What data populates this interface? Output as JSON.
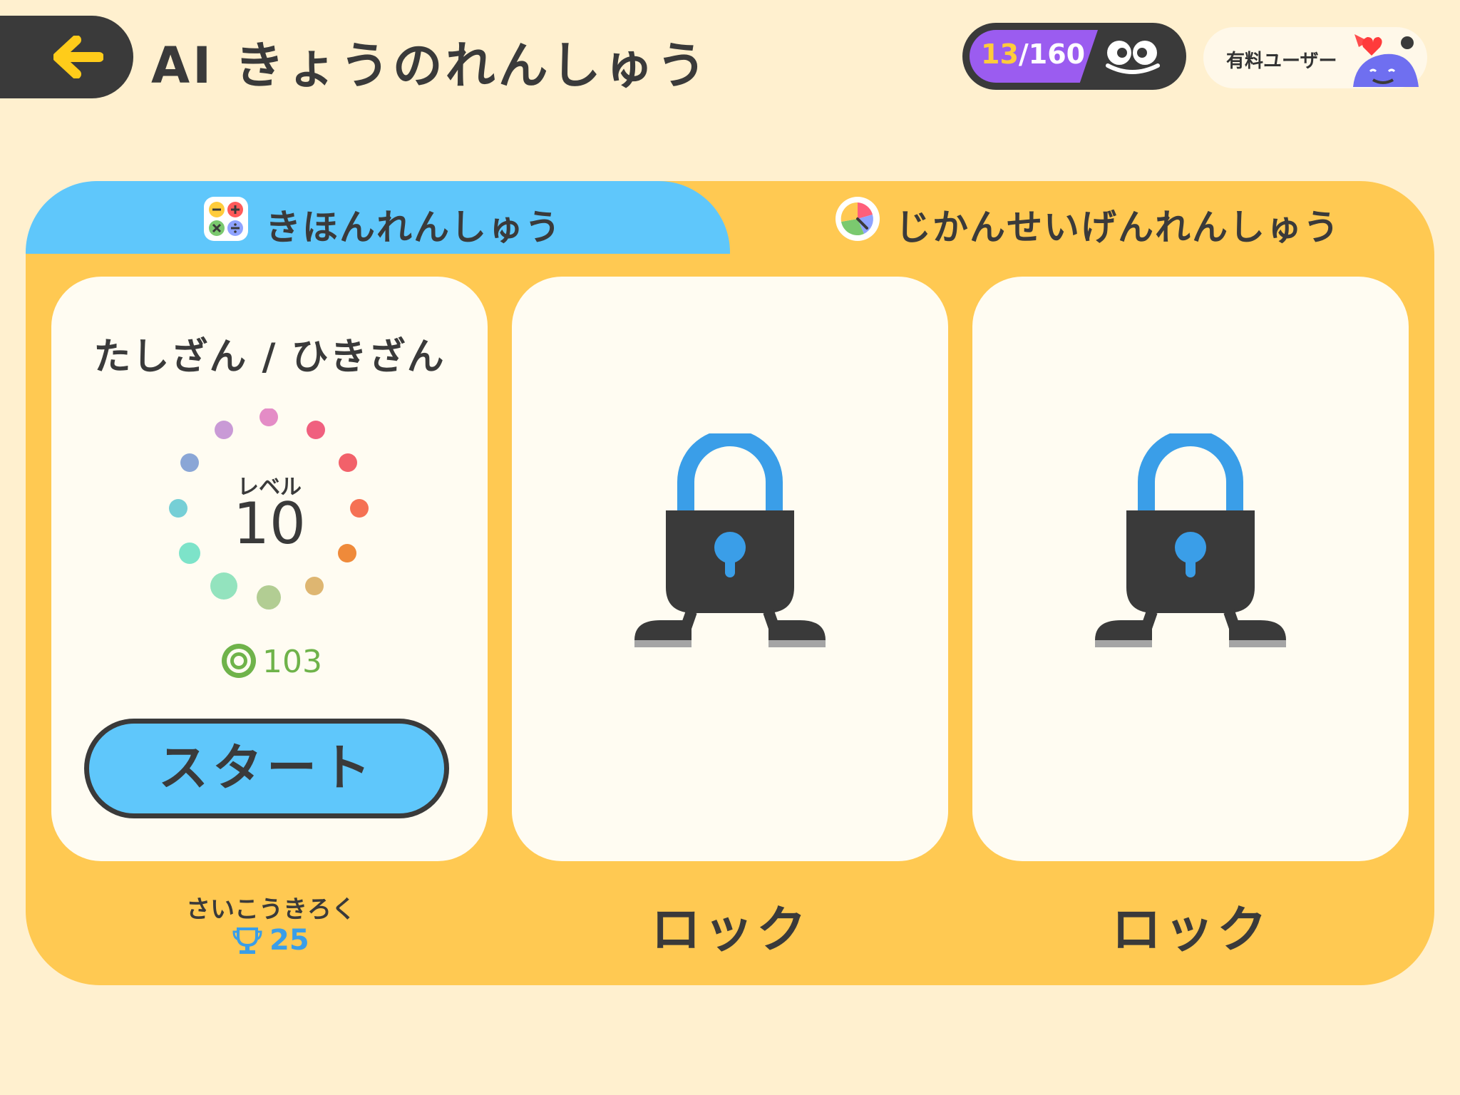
{
  "header": {
    "title": "AI きょうのれんしゅう",
    "back_icon": "arrow-left-icon"
  },
  "counter": {
    "current": "13",
    "total": "/160",
    "icon": "monster-eyes-icon"
  },
  "user": {
    "label": "有料ユーザー",
    "icon": "purple-monster-avatar"
  },
  "tabs": [
    {
      "label": "きほんれんしゅう",
      "icon": "arithmetic-icon",
      "active": true
    },
    {
      "label": "じかんせいげんれんしゅう",
      "icon": "timer-pie-icon",
      "active": false
    }
  ],
  "cards": [
    {
      "title": "たしざん / ひきざん",
      "level_label": "レベル",
      "level_value": "10",
      "coins": "103",
      "button": "スタート",
      "record_label": "さいこうきろく",
      "record_value": "25"
    },
    {
      "status": "ロック",
      "icon": "padlock-icon"
    },
    {
      "status": "ロック",
      "icon": "padlock-icon"
    }
  ],
  "colors": {
    "background": "#fff0cf",
    "panel": "#ffc952",
    "active_tab": "#5fc7fb",
    "accent_dark": "#3a3a3a",
    "lock_blue": "#3a9ee8",
    "counter_purple": "#9b5cf0"
  }
}
